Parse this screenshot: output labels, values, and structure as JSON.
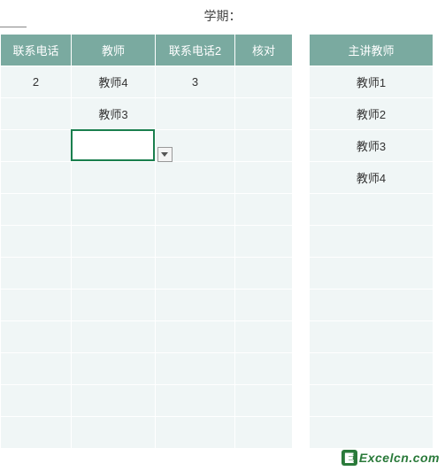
{
  "header": {
    "semester_label": "学期："
  },
  "main_table": {
    "columns": [
      "联系电话",
      "教师",
      "联系电话2",
      "核对"
    ],
    "rows": [
      [
        "2",
        "教师4",
        "3",
        ""
      ],
      [
        "",
        "教师3",
        "",
        ""
      ],
      [
        "",
        "",
        "",
        ""
      ],
      [
        "",
        "",
        "",
        ""
      ],
      [
        "",
        "",
        "",
        ""
      ],
      [
        "",
        "",
        "",
        ""
      ],
      [
        "",
        "",
        "",
        ""
      ],
      [
        "",
        "",
        "",
        ""
      ],
      [
        "",
        "",
        "",
        ""
      ],
      [
        "",
        "",
        "",
        ""
      ],
      [
        "",
        "",
        "",
        ""
      ],
      [
        "",
        "",
        "",
        ""
      ]
    ]
  },
  "side_table": {
    "columns": [
      "主讲教师"
    ],
    "rows": [
      [
        "教师1"
      ],
      [
        "教师2"
      ],
      [
        "教师3"
      ],
      [
        "教师4"
      ],
      [
        ""
      ],
      [
        ""
      ],
      [
        ""
      ],
      [
        ""
      ],
      [
        ""
      ],
      [
        ""
      ],
      [
        ""
      ],
      [
        ""
      ]
    ]
  },
  "active_cell": {
    "row": 2,
    "col": 1
  },
  "watermark": {
    "badge": "E",
    "text": "Excelcn.com"
  }
}
